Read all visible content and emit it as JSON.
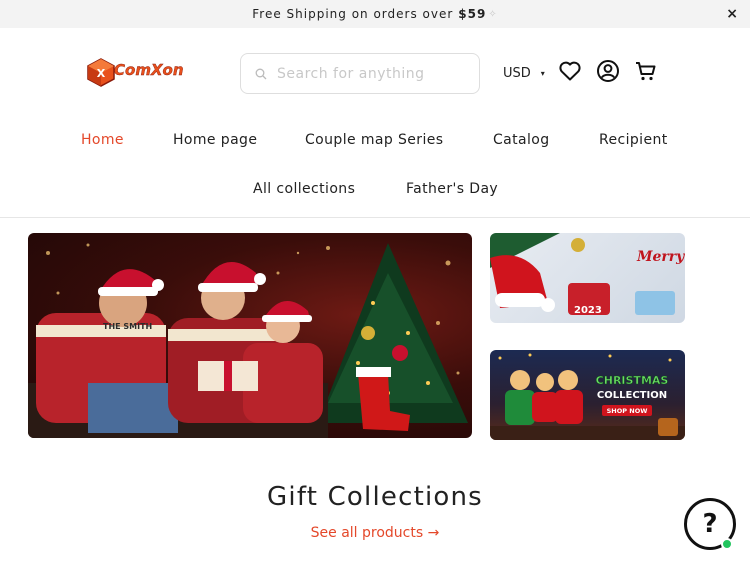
{
  "announcement": {
    "text": "Free Shipping on orders over",
    "amount": "$59",
    "close": "×"
  },
  "brand": {
    "logo_text": "ComXon"
  },
  "search": {
    "placeholder": "Search for anything"
  },
  "currency": {
    "selected": "USD",
    "caret": "▾"
  },
  "header_icons": [
    "heart-icon",
    "account-icon",
    "cart-icon"
  ],
  "nav": {
    "row1": [
      "Home",
      "Home page",
      "Couple map Series",
      "Catalog",
      "Recipient"
    ],
    "row2": [
      "All collections",
      "Father's Day"
    ]
  },
  "banners": {
    "hero_shirt_text": "THE SMITH",
    "side1_text": "Merry Christmas",
    "side1_year": "2023",
    "side2_title": "CHRISTMAS COLLECTION",
    "side2_button": "SHOP NOW"
  },
  "collections": {
    "title": "Gift Collections",
    "see_all": "See all products →"
  },
  "help": {
    "label": "?"
  },
  "colors": {
    "accent": "#e4482a",
    "online": "#22c55e"
  }
}
